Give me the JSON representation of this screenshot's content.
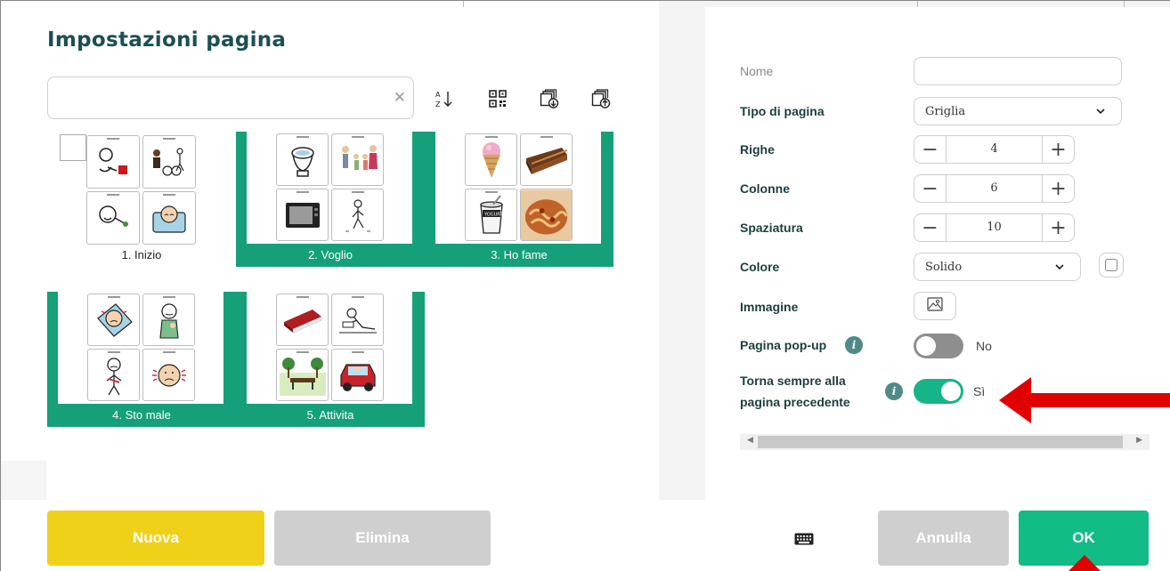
{
  "dialog": {
    "title": "Impostazioni pagina",
    "search": {
      "placeholder": "",
      "value": ""
    },
    "toolbar": {
      "sort_icon": "sort-az-icon",
      "qr_icon": "qr-code-icon",
      "import_icon": "import-page-icon",
      "export_icon": "export-page-icon"
    }
  },
  "pages": [
    {
      "label": "1. Inizio",
      "selected": false
    },
    {
      "label": "2. Voglio",
      "selected": true
    },
    {
      "label": "3. Ho fame",
      "selected": true
    },
    {
      "label": "4. Sto male",
      "selected": true
    },
    {
      "label": "5. Attivita",
      "selected": true
    }
  ],
  "form": {
    "nome": {
      "label": "Nome",
      "value": ""
    },
    "tipo": {
      "label": "Tipo di pagina",
      "value": "Griglia"
    },
    "righe": {
      "label": "Righe",
      "value": "4"
    },
    "colonne": {
      "label": "Colonne",
      "value": "6"
    },
    "spaziatura": {
      "label": "Spaziatura",
      "value": "10"
    },
    "colore": {
      "label": "Colore",
      "value": "Solido"
    },
    "immagine": {
      "label": "Immagine"
    },
    "popup": {
      "label": "Pagina pop-up",
      "state": "No",
      "on": false
    },
    "torna": {
      "label_line1": "Torna sempre alla",
      "label_line2": "pagina precedente",
      "state": "Sì",
      "on": true
    }
  },
  "buttons": {
    "nuova": "Nuova",
    "elimina": "Elimina",
    "annulla": "Annulla",
    "ok": "OK"
  },
  "colors": {
    "title": "#1c4f53",
    "selected_tile": "#16a07a",
    "toggle_on": "#16b487",
    "toggle_off": "#8e8e8e",
    "nuova": "#f0d11a",
    "ok": "#12bc86",
    "disabled": "#cfcfcf",
    "annotation_arrow": "#e00000"
  }
}
